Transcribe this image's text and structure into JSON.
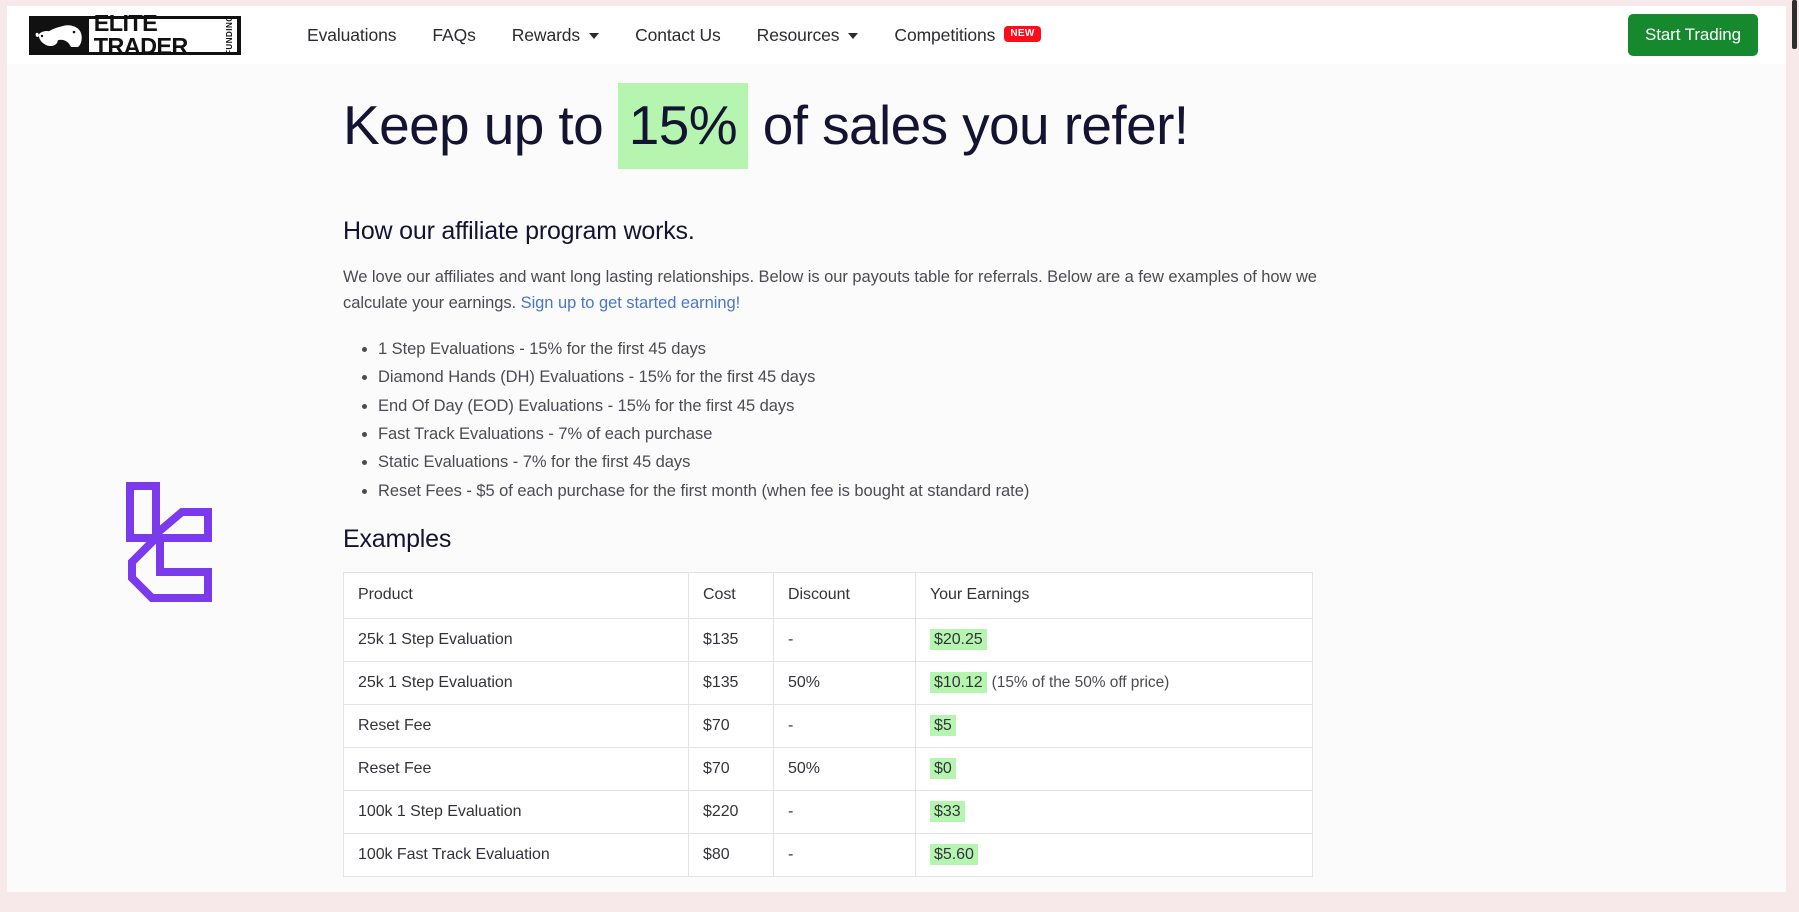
{
  "brand": {
    "main_text": "ELITE TRADER",
    "sub_text": "FUNDING",
    "icon": "bull-bear-icon"
  },
  "nav": {
    "items": [
      {
        "label": "Evaluations",
        "has_caret": false,
        "badge": null
      },
      {
        "label": "FAQs",
        "has_caret": false,
        "badge": null
      },
      {
        "label": "Rewards",
        "has_caret": true,
        "badge": null
      },
      {
        "label": "Contact Us",
        "has_caret": false,
        "badge": null
      },
      {
        "label": "Resources",
        "has_caret": true,
        "badge": null
      },
      {
        "label": "Competitions",
        "has_caret": false,
        "badge": "NEW"
      }
    ],
    "cta_label": "Start Trading",
    "cta_color": "#16892f",
    "badge_color": "#fb0d1b"
  },
  "hero": {
    "before": "Keep up to",
    "highlight": "15%",
    "after": "of sales you refer!",
    "highlight_color": "#b6f5b0"
  },
  "section": {
    "title": "How our affiliate program works.",
    "lede_before": "We love our affiliates and want long lasting relationships. Below is our payouts table for referrals. Below are a few examples of how we calculate your earnings. ",
    "lede_link": "Sign up to get started earning!",
    "link_color": "#4a77c9"
  },
  "payouts": [
    "1 Step Evaluations - 15% for the first 45 days",
    "Diamond Hands (DH) Evaluations - 15% for the first 45 days",
    "End Of Day (EOD) Evaluations - 15% for the first 45 days",
    "Fast Track Evaluations - 7% of each purchase",
    "Static Evaluations - 7% for the first 45 days",
    "Reset Fees - $5 of each purchase for the first month (when fee is bought at standard rate)"
  ],
  "examples": {
    "title": "Examples",
    "columns": [
      "Product",
      "Cost",
      "Discount",
      "Your Earnings"
    ],
    "rows": [
      {
        "product": "25k 1 Step Evaluation",
        "cost": "$135",
        "discount": "-",
        "earnings": "$20.25",
        "note": ""
      },
      {
        "product": "25k 1 Step Evaluation",
        "cost": "$135",
        "discount": "50%",
        "earnings": "$10.12",
        "note": "(15% of the 50% off price)"
      },
      {
        "product": "Reset Fee",
        "cost": "$70",
        "discount": "-",
        "earnings": "$5",
        "note": ""
      },
      {
        "product": "Reset Fee",
        "cost": "$70",
        "discount": "50%",
        "earnings": "$0",
        "note": ""
      },
      {
        "product": "100k 1 Step Evaluation",
        "cost": "$220",
        "discount": "-",
        "earnings": "$33",
        "note": ""
      },
      {
        "product": "100k Fast Track Evaluation",
        "cost": "$80",
        "discount": "-",
        "earnings": "$5.60",
        "note": ""
      }
    ],
    "earnings_highlight_color": "#b6f5b0"
  },
  "decor": {
    "mark_name": "lc-monogram-logo",
    "mark_color": "#7c3aed"
  }
}
